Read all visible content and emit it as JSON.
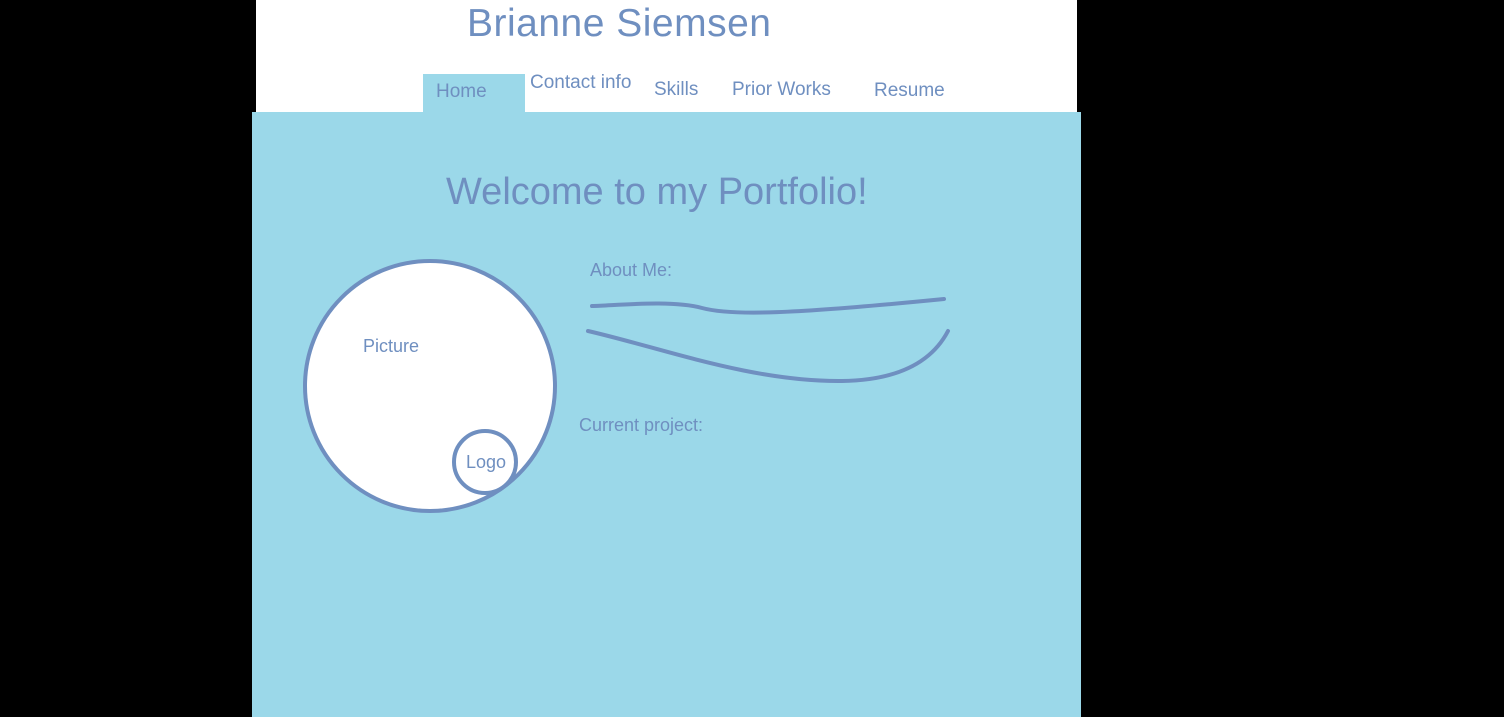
{
  "header": {
    "title": "Brianne Siemsen"
  },
  "nav": {
    "home": "Home",
    "contact": "Contact info",
    "skills": "Skills",
    "prior_works": "Prior Works",
    "resume": "Resume"
  },
  "main": {
    "heading": "Welcome to my Portfolio!",
    "picture_label": "Picture",
    "logo_label": "Logo",
    "about_label": "About Me:",
    "project_label": "Current project:"
  },
  "colors": {
    "page_background": "#000000",
    "header_background": "#ffffff",
    "content_background": "#9bd8e9",
    "text_and_stroke": "#6f8fc0"
  }
}
